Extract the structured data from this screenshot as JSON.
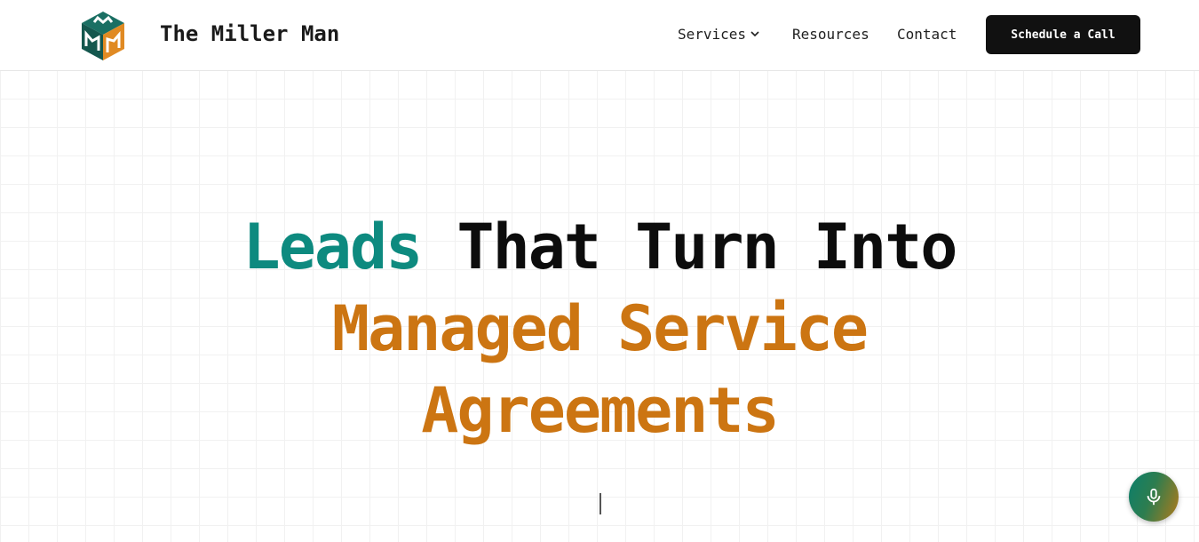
{
  "header": {
    "brand": "The Miller Man",
    "nav": {
      "services": "Services",
      "resources": "Resources",
      "contact": "Contact"
    },
    "cta": "Schedule a Call"
  },
  "hero": {
    "line1_part1": "Leads",
    "line1_part2": "That Turn Into",
    "line2": "Managed Service",
    "line3": "Agreements"
  },
  "icons": {
    "logo": "mm-cube-logo",
    "services_dropdown": "chevron-down-icon",
    "voice": "microphone-icon"
  },
  "colors": {
    "teal": "#0d8a7f",
    "orange": "#cc7512",
    "dark": "#0c0c0c",
    "cta_bg": "#111111"
  }
}
